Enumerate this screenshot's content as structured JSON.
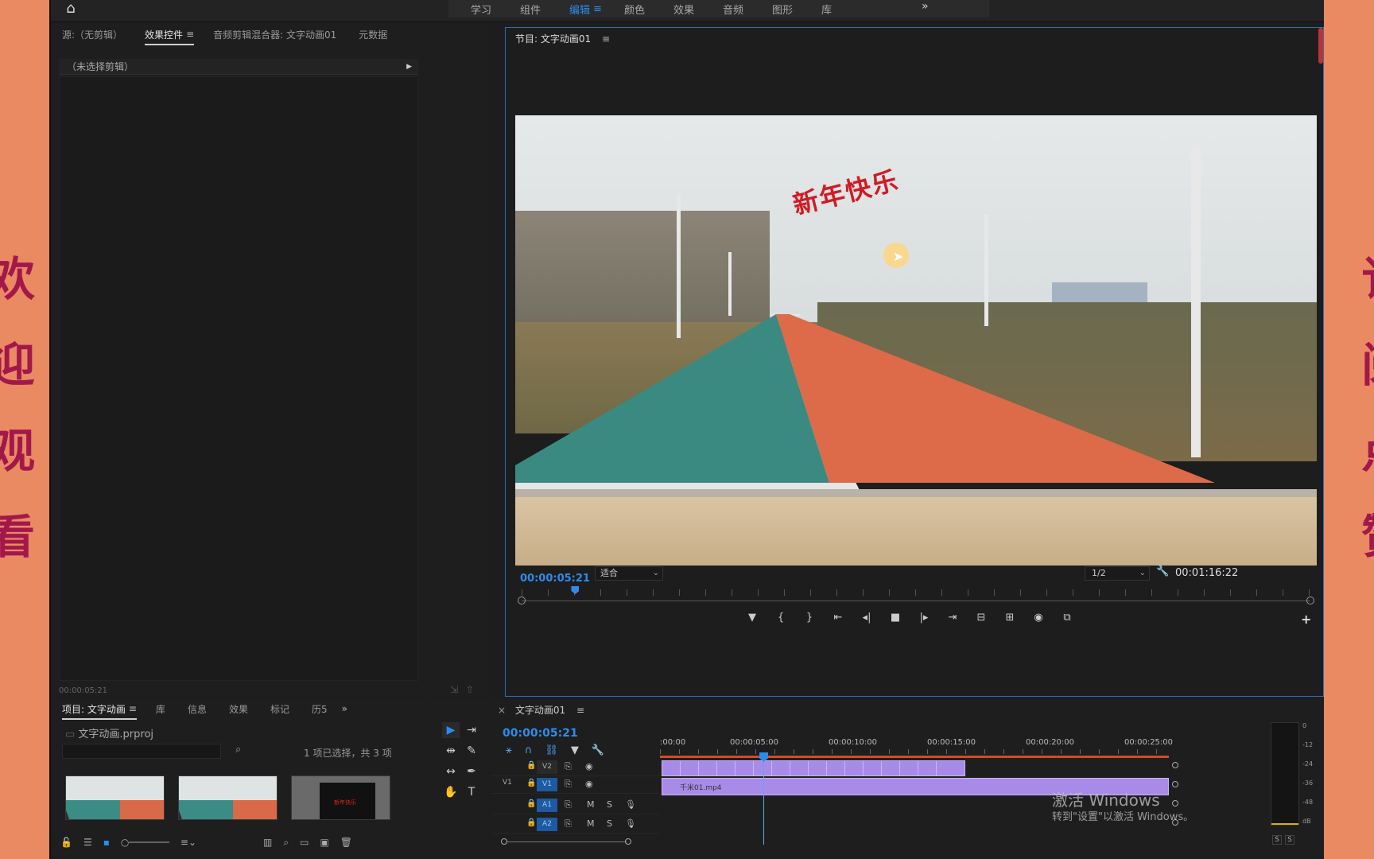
{
  "side_chars_left": [
    "欢",
    "迎",
    "观",
    "看"
  ],
  "side_chars_right": [
    "订",
    "阅",
    "点",
    "赞"
  ],
  "workspace": {
    "tabs": [
      "学习",
      "组件",
      "编辑",
      "颜色",
      "效果",
      "音频",
      "图形",
      "库"
    ],
    "active": "编辑",
    "more": "»"
  },
  "source_panel": {
    "tabs": [
      "源:（无剪辑）",
      "效果控件",
      "音频剪辑混合器: 文字动画01",
      "元数据"
    ],
    "active_tab": "效果控件",
    "header": "（未选择剪辑）",
    "timecode": "00:00:05:21"
  },
  "program": {
    "tab": "节目: 文字动画01",
    "video_text": "新年快乐",
    "timecode": "00:00:05:21",
    "fit": "适合",
    "resolution": "1/2",
    "duration": "00:01:16:22",
    "playhead_fraction": 0.068
  },
  "transport": [
    "▼",
    "{",
    "}",
    "⇤",
    "◂|",
    "■",
    "|▸",
    "⇥",
    "⊟",
    "⊞",
    "◉",
    "⧉"
  ],
  "project": {
    "tabs": [
      "项目: 文字动画",
      "库",
      "信息",
      "效果",
      "标记",
      "历5"
    ],
    "active_tab": "项目: 文字动画",
    "file": "文字动画.prproj",
    "search_placeholder": "",
    "selection_info": "1 项已选择，共 3 项",
    "thumb_text": "新年快乐"
  },
  "timeline": {
    "tab": "文字动画01",
    "timecode": "00:00:05:21",
    "ruler": [
      ":00:00",
      "00:00:05:00",
      "00:00:10:00",
      "00:00:15:00",
      "00:00:20:00",
      "00:00:25:00"
    ],
    "tracks": [
      {
        "id": "V2",
        "left": ""
      },
      {
        "id": "V1",
        "left": "V1"
      },
      {
        "id": "A1",
        "left": ""
      },
      {
        "id": "A2",
        "left": ""
      }
    ],
    "clip_label": "千米01.mp4",
    "watermark_title": "激活 Windows",
    "watermark_sub": "转到\"设置\"以激活 Windows。"
  },
  "meter": {
    "labels": [
      "0",
      "-12",
      "-24",
      "-36",
      "-48",
      "dB"
    ],
    "solo": [
      "S",
      "S"
    ]
  }
}
